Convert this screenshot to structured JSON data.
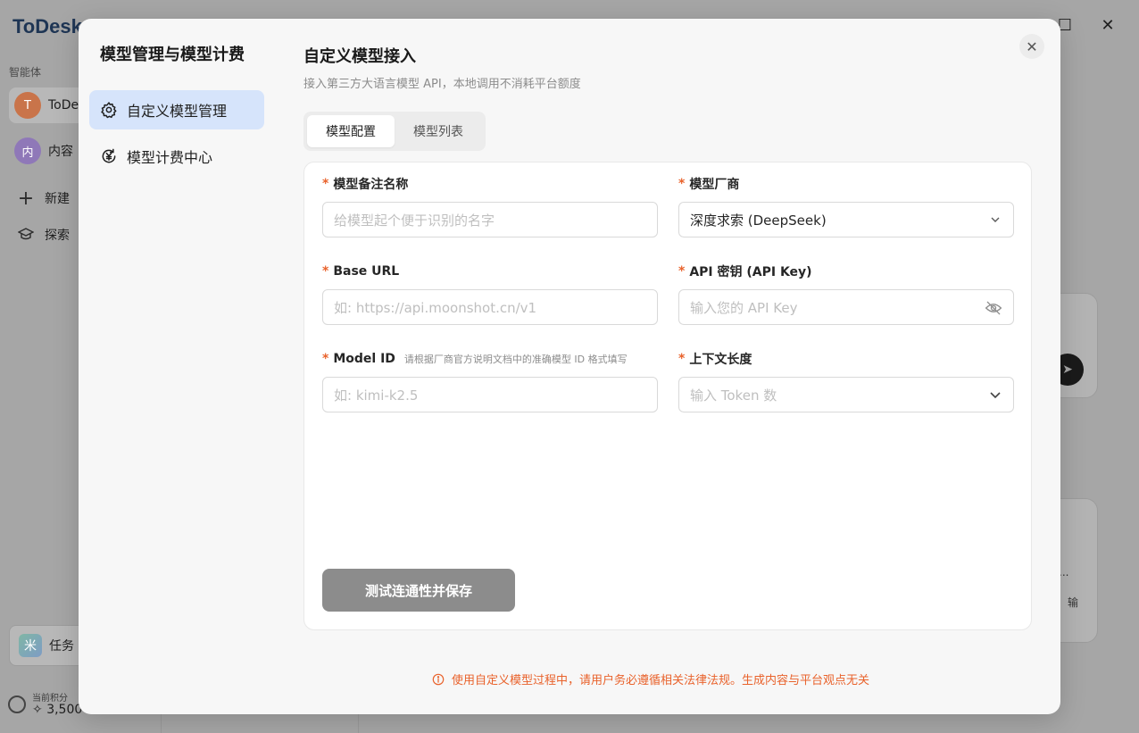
{
  "background": {
    "app_logo": "ToDesk",
    "sidebar_section": "智能体",
    "items": [
      {
        "avatar": "T",
        "label": "ToDe",
        "color": "#c9744a"
      },
      {
        "avatar": "内",
        "label": "内容",
        "color": "#8f78b8"
      },
      {
        "label": "新建"
      },
      {
        "label": "探索"
      }
    ],
    "task_label": "任务",
    "task_icon": "米",
    "credits_label": "当前积分",
    "credits_value": "3,500",
    "right_card_text_1": "...",
    "right_card_text_2": "输"
  },
  "modal": {
    "heading": "模型管理与模型计费",
    "nav": [
      {
        "label": "自定义模型管理",
        "icon": "gear-icon",
        "active": true
      },
      {
        "label": "模型计费中心",
        "icon": "yuan-cycle-icon",
        "active": false
      }
    ],
    "title": "自定义模型接入",
    "subtitle": "接入第三方大语言模型 API，本地调用不消耗平台额度",
    "tabs": [
      {
        "label": "模型配置",
        "active": true
      },
      {
        "label": "模型列表",
        "active": false
      }
    ],
    "form": {
      "name": {
        "label": "模型备注名称",
        "placeholder": "给模型起个便于识别的名字"
      },
      "vendor": {
        "label": "模型厂商",
        "value": "深度求索 (DeepSeek)"
      },
      "base_url": {
        "label": "Base URL",
        "placeholder": "如: https://api.moonshot.cn/v1"
      },
      "api_key": {
        "label": "API 密钥 (API Key)",
        "placeholder": "输入您的 API Key"
      },
      "model_id": {
        "label": "Model ID",
        "hint": "请根据厂商官方说明文档中的准确模型 ID 格式填写",
        "placeholder": "如: kimi-k2.5"
      },
      "context": {
        "label": "上下文长度",
        "placeholder": "输入 Token 数"
      },
      "required_mark": "*"
    },
    "save_label": "测试连通性并保存",
    "notice": "使用自定义模型过程中，请用户务必遵循相关法律法规。生成内容与平台观点无关",
    "close_glyph": "✕"
  }
}
